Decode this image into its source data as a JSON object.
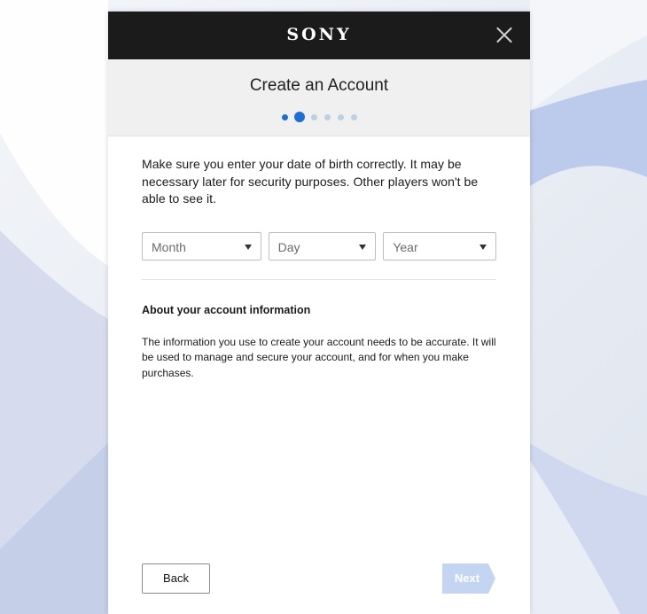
{
  "header": {
    "brand": "SONY",
    "title": "Create an Account"
  },
  "progress": {
    "total_steps": 6,
    "current_step": 2
  },
  "form": {
    "intro": "Make sure you enter your date of birth correctly. It may be necessary later for security purposes. Other players won't be able to see it.",
    "month_placeholder": "Month",
    "day_placeholder": "Day",
    "year_placeholder": "Year"
  },
  "about": {
    "title": "About your account information",
    "text": "The information you use to create your account needs to be accurate. It will be used to manage and secure your account, and for when you make purchases."
  },
  "buttons": {
    "back": "Back",
    "next": "Next"
  },
  "colors": {
    "accent": "#1f6fd0",
    "next_disabled": "#c3d5f0",
    "topbar": "#1b1b1b"
  }
}
